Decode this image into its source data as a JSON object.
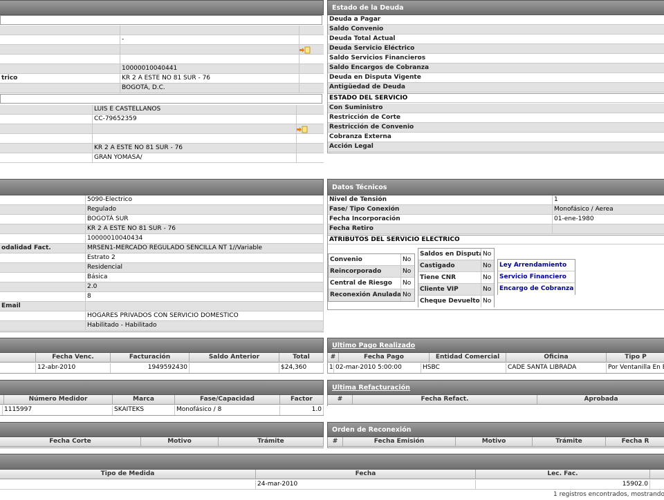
{
  "left1": {
    "rows": [
      {
        "a": "",
        "b": ""
      },
      {
        "a": "",
        "b": "-"
      },
      {
        "a": "",
        "b": ""
      },
      {
        "a": "",
        "b": ""
      },
      {
        "a": "",
        "b": "10000010040441"
      },
      {
        "a": "trico",
        "b": "KR 2 A ESTE NO 81 SUR - 76"
      },
      {
        "a": "",
        "b": "BOGOTÁ, D.C."
      }
    ],
    "rows2": [
      {
        "a": "",
        "b": "LUIS E CASTELLANOS"
      },
      {
        "a": "",
        "b": "CC-79652359"
      },
      {
        "a": "",
        "b": ""
      },
      {
        "a": "",
        "b": ""
      },
      {
        "a": "",
        "b": "KR 2 A ESTE NO 81 SUR - 76"
      },
      {
        "a": "",
        "b": "GRAN YOMASA/"
      }
    ]
  },
  "deuda": {
    "title": "Estado de la Deuda",
    "rows": [
      "Deuda a Pagar",
      "Saldo Convenio",
      "Deuda Total Actual",
      "Deuda Servicio Eléctrico",
      "Saldo Servicios Financieros",
      "Saldo Encargos de Cobranza",
      "Deuda en Disputa Vigente",
      "Antigüedad de Deuda"
    ],
    "estado_title": "ESTADO DEL SERVICIO",
    "estado_rows": [
      "Con Suministro",
      "Restricción de Corte",
      "Restricción de Convenio",
      "Cobranza Externa",
      "Acción Legal"
    ]
  },
  "left2": {
    "rows": [
      {
        "a": "",
        "b": "5090-Electrico"
      },
      {
        "a": "",
        "b": "Regulado"
      },
      {
        "a": "",
        "b": "BOGOTÁ SUR"
      },
      {
        "a": "",
        "b": "KR 2 A ESTE NO 81 SUR - 76"
      },
      {
        "a": "",
        "b": "10000010040434"
      },
      {
        "a": "odalidad Fact.",
        "b": "MRSEN1-MERCADO REGULADO SENCILLA NT 1//Variable"
      },
      {
        "a": "",
        "b": "Estrato 2"
      },
      {
        "a": "",
        "b": "Residencial"
      },
      {
        "a": "",
        "b": "Básica"
      },
      {
        "a": "",
        "b": "2.0"
      },
      {
        "a": "",
        "b": "8"
      },
      {
        "a": "Email",
        "b": ""
      },
      {
        "a": "",
        "b": "HOGARES PRIVADOS CON SERVICIO DOMESTICO"
      },
      {
        "a": "",
        "b": "Habilitado - Habilitado"
      }
    ]
  },
  "tecnicos": {
    "title": "Datos Técnicos",
    "rows": [
      {
        "k": "Nivel de Tensión",
        "v": "1"
      },
      {
        "k": "Fase/ Tipo Conexión",
        "v": "Monofásico / Aerea"
      },
      {
        "k": "Fecha Incorporación",
        "v": "01-ene-1980"
      },
      {
        "k": "Fecha Retiro",
        "v": ""
      }
    ],
    "atributos_title": "ATRIBUTOS DEL SERVICIO ELECTRICO",
    "col1": [
      {
        "k": "Convenio",
        "v": "No"
      },
      {
        "k": "Reincorporado",
        "v": "No"
      },
      {
        "k": "Central de Riesgo",
        "v": "No"
      },
      {
        "k": "Reconexión Anulada",
        "v": "No"
      }
    ],
    "col2": [
      {
        "k": "Saldos en Disputa",
        "v": "No"
      },
      {
        "k": "Castigado",
        "v": "No"
      },
      {
        "k": "Tiene CNR",
        "v": "No"
      },
      {
        "k": "Cliente VIP",
        "v": "No"
      },
      {
        "k": "Cheque Devuelto",
        "v": "No"
      }
    ],
    "links": [
      "Ley Arrendamiento",
      "Servicio Financiero",
      "Encargo de Cobranza"
    ]
  },
  "facturacion": {
    "headers": [
      "Fecha Venc.",
      "Facturación",
      "Saldo Anterior",
      "Total"
    ],
    "row": [
      "12-abr-2010",
      "1949592430",
      "",
      "$24,360"
    ]
  },
  "pago": {
    "title": "Ultimo Pago Realizado",
    "headers": [
      "#",
      "Fecha Pago",
      "Entidad Comercial",
      "Oficina",
      "Tipo P"
    ],
    "row": [
      "1",
      "02-mar-2010 5:00:00",
      "HSBC",
      "CADE SANTA LIBRADA",
      "Por Ventanilla En E"
    ]
  },
  "medidor": {
    "headers": [
      "Número Medidor",
      "Marca",
      "Fase/Capacidad",
      "Factor"
    ],
    "row": [
      "1115997",
      "SKAITEKS",
      "Monofásico / 8",
      "1.0"
    ]
  },
  "refact": {
    "title": "Ultima Refacturación",
    "headers": [
      "#",
      "Fecha Refact.",
      "Aprobada"
    ]
  },
  "corte": {
    "headers": [
      "Fecha Corte",
      "Motivo",
      "Trámite"
    ]
  },
  "reconexion": {
    "title": "Orden de Reconexión",
    "headers": [
      "#",
      "Fecha Emisión",
      "Motivo",
      "Trámite",
      "Fecha R"
    ]
  },
  "medida": {
    "headers": [
      "Tipo de Medida",
      "Fecha",
      "Lec. Fac."
    ],
    "row": [
      "",
      "24-mar-2010",
      "15902.0"
    ],
    "footer": "1 registros encontrados, mostrando"
  }
}
